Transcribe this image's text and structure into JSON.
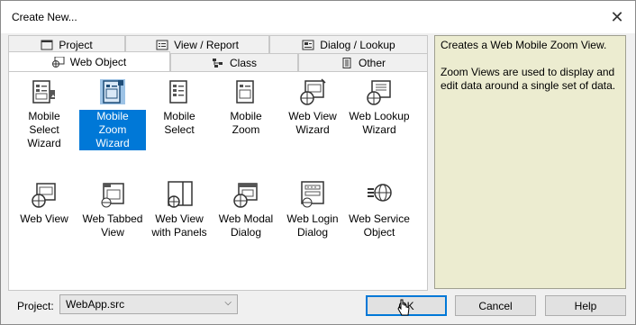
{
  "window": {
    "title": "Create New..."
  },
  "tabs_row1": [
    {
      "label": "Project",
      "icon": "window-icon"
    },
    {
      "label": "View / Report",
      "icon": "form-icon"
    },
    {
      "label": "Dialog / Lookup",
      "icon": "dialog-icon"
    }
  ],
  "tabs_row2": [
    {
      "label": "Web Object",
      "icon": "web-object-icon",
      "active": true
    },
    {
      "label": "Class",
      "icon": "class-icon"
    },
    {
      "label": "Other",
      "icon": "document-icon"
    }
  ],
  "items": [
    {
      "label1": "Mobile Select",
      "label2": "Wizard",
      "icon": "mobile-select-wizard-icon",
      "selected": false
    },
    {
      "label1": "Mobile",
      "label2": "Zoom Wizard",
      "icon": "mobile-zoom-wizard-icon",
      "selected": true
    },
    {
      "label1": "Mobile Select",
      "label2": "",
      "icon": "mobile-select-icon",
      "selected": false
    },
    {
      "label1": "Mobile",
      "label2": "Zoom",
      "icon": "mobile-zoom-icon",
      "selected": false
    },
    {
      "label1": "Web View",
      "label2": "Wizard",
      "icon": "web-view-wizard-icon",
      "selected": false
    },
    {
      "label1": "Web Lookup",
      "label2": "Wizard",
      "icon": "web-lookup-wizard-icon",
      "selected": false
    },
    {
      "label1": "Web View",
      "label2": "",
      "icon": "web-view-icon",
      "selected": false
    },
    {
      "label1": "Web Tabbed",
      "label2": "View",
      "icon": "web-tabbed-view-icon",
      "selected": false
    },
    {
      "label1": "Web View",
      "label2": "with Panels",
      "icon": "web-view-panels-icon",
      "selected": false
    },
    {
      "label1": "Web Modal",
      "label2": "Dialog",
      "icon": "web-modal-dialog-icon",
      "selected": false
    },
    {
      "label1": "Web Login",
      "label2": "Dialog",
      "icon": "web-login-dialog-icon",
      "selected": false
    },
    {
      "label1": "Web Service",
      "label2": "Object",
      "icon": "web-service-object-icon",
      "selected": false
    }
  ],
  "description": {
    "line1": "Creates a Web Mobile Zoom View.",
    "line2": "Zoom Views are used to display and edit data around a single set of data."
  },
  "project": {
    "label": "Project:",
    "value": "WebApp.src"
  },
  "buttons": {
    "ok": "OK",
    "cancel": "Cancel",
    "help": "Help"
  },
  "colors": {
    "selection": "#0078d7",
    "description_bg": "#ececd0"
  }
}
